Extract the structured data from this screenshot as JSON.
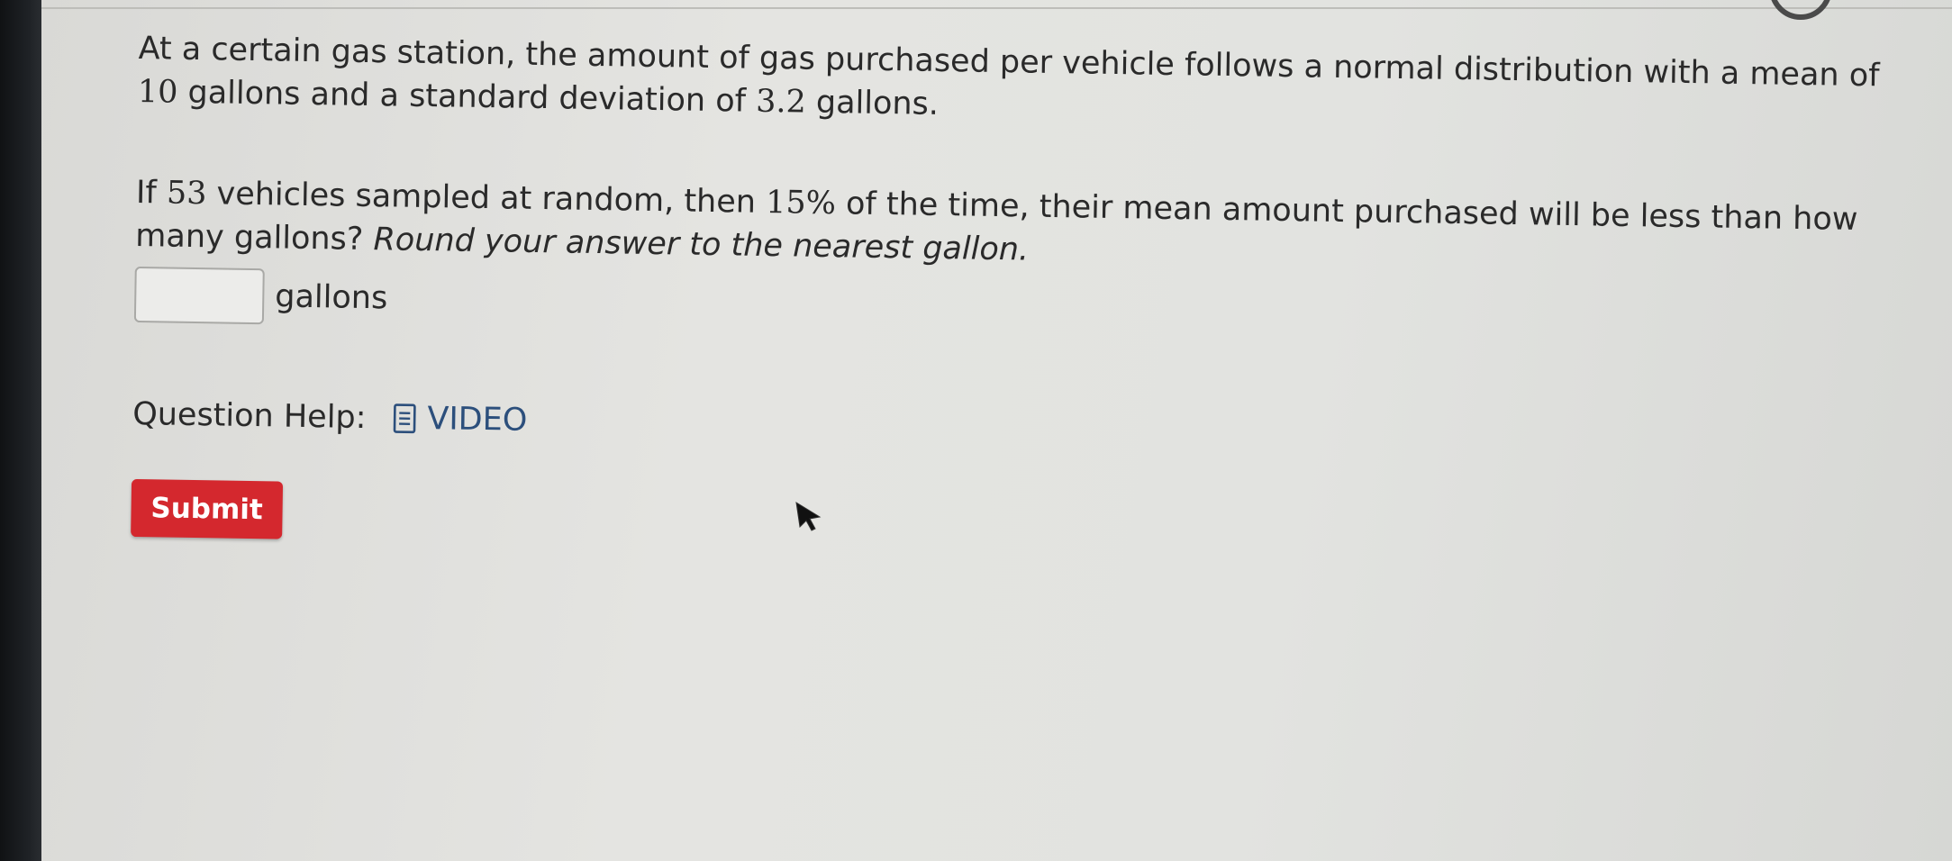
{
  "question": {
    "p1_a": "At a certain gas station, the amount of gas purchased per vehicle follows a normal distribution with a mean of ",
    "mean": "10",
    "p1_b": " gallons and a standard deviation of ",
    "sd": "3.2",
    "p1_c": " gallons.",
    "p2_a": "If ",
    "n": "53",
    "p2_b": " vehicles sampled at random, then ",
    "pct": "15%",
    "p2_c": " of the time, their mean amount purchased will be less than how many gallons? ",
    "instruction": "Round your answer to the nearest gallon."
  },
  "answer": {
    "value": "",
    "unit": "gallons"
  },
  "help": {
    "label": "Question Help:",
    "video_label": "VIDEO",
    "icon": "document-icon"
  },
  "submit_label": "Submit",
  "colors": {
    "submit_bg": "#d4282e",
    "link": "#2c4f7c"
  }
}
